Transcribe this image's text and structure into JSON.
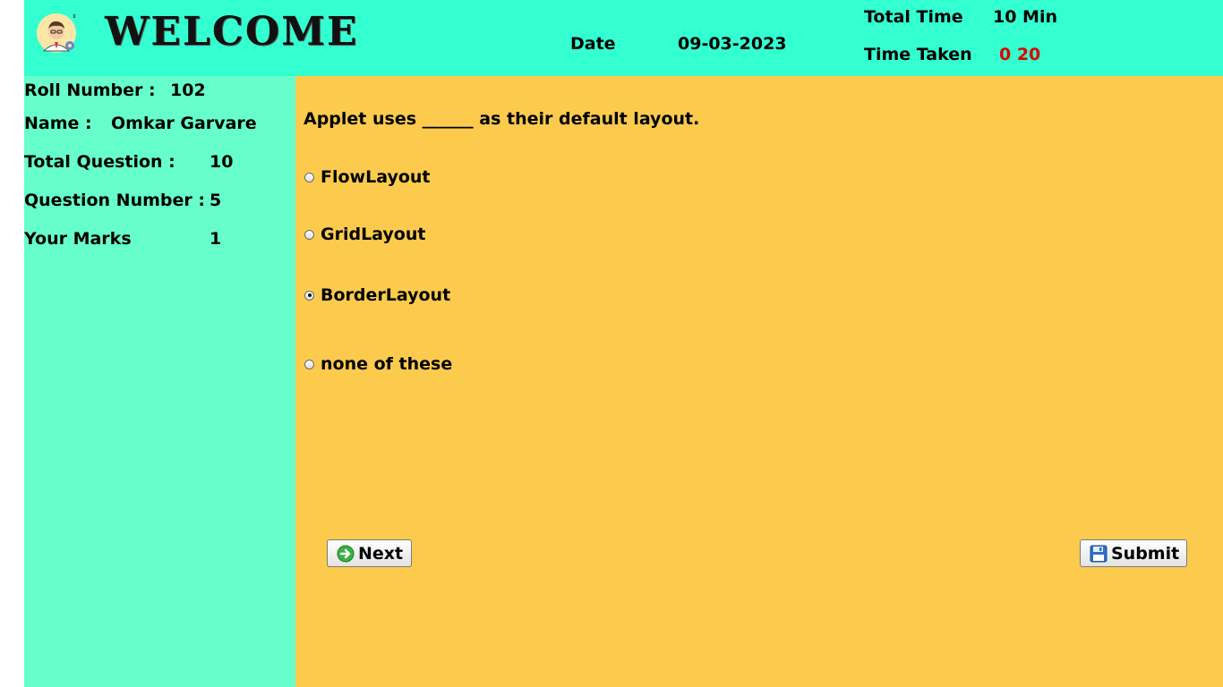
{
  "header": {
    "welcome": "WELCOME",
    "date_label": "Date",
    "date_value": "09-03-2023",
    "total_time_label": "Total Time",
    "total_time_value": "10 Min",
    "time_taken_label": "Time Taken",
    "time_taken_value": "0 20"
  },
  "sidebar": {
    "roll_label": "Roll Number :",
    "roll_value": "102",
    "name_label": "Name :",
    "name_value": "Omkar Garvare",
    "total_question_label": "Total Question :",
    "total_question_value": "10",
    "question_number_label": "Question Number :",
    "question_number_value": "5",
    "marks_label": "Your Marks",
    "marks_value": "1"
  },
  "question": {
    "text": "Applet uses ______ as their default layout.",
    "options": [
      "FlowLayout",
      "GridLayout",
      "BorderLayout",
      "none of these"
    ],
    "selected_index": 2
  },
  "buttons": {
    "next": "Next",
    "submit": "Submit"
  },
  "icons": {
    "avatar": "user-avatar-icon",
    "next": "arrow-right-circle-icon",
    "submit": "floppy-disk-icon"
  },
  "colors": {
    "header_bg": "#33ffd0",
    "sidebar_bg": "#66ffcc",
    "main_bg": "#fccb4e",
    "time_taken": "#e00000"
  }
}
